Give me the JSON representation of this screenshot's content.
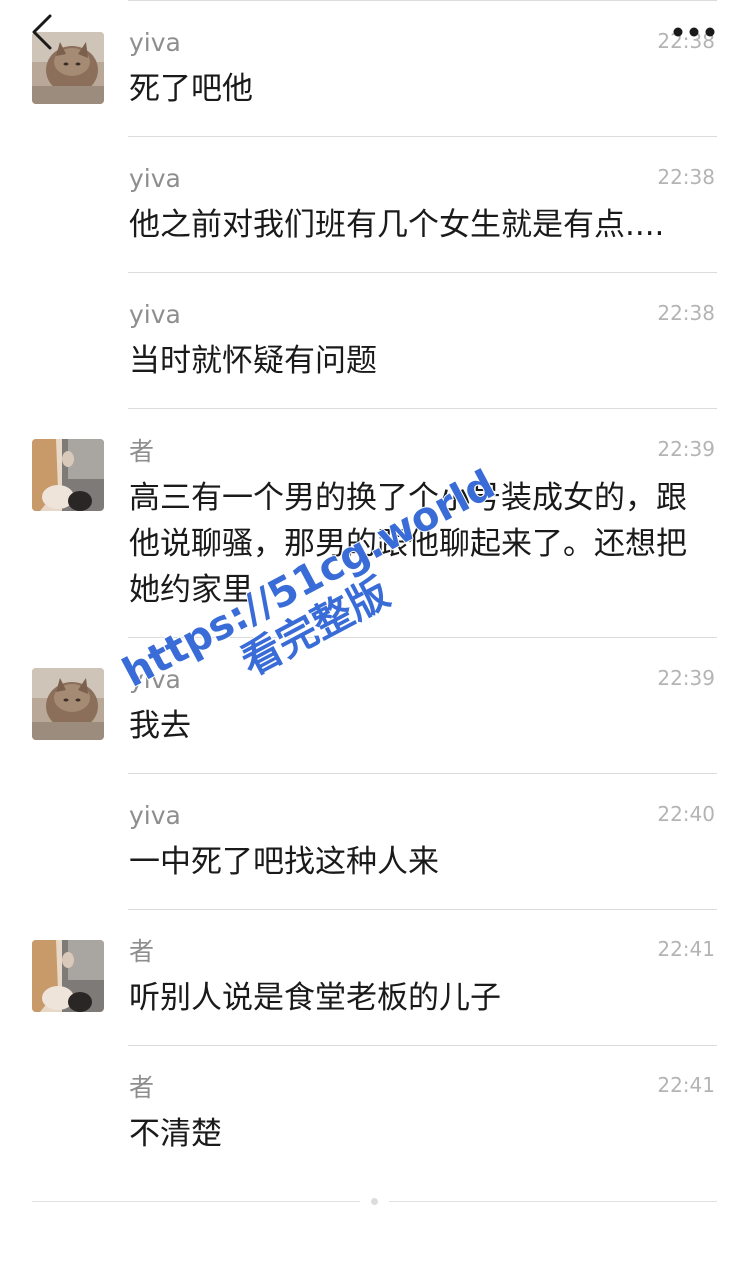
{
  "header": {
    "back_icon": "chevron-left-icon",
    "more_icon": "more-dots-icon"
  },
  "messages": [
    {
      "sender": "yiva",
      "time": "22:38",
      "text": "死了吧他",
      "avatar": "cat-avatar"
    },
    {
      "sender": "yiva",
      "time": "22:38",
      "text": "他之前对我们班有几个女生就是有点....",
      "avatar": ""
    },
    {
      "sender": "yiva",
      "time": "22:38",
      "text": "当时就怀疑有问题",
      "avatar": ""
    },
    {
      "sender": "者",
      "time": "22:39",
      "text": "高三有一个男的换了个小号装成女的，跟他说聊骚，那男的跟他聊起来了。还想把她约家里",
      "avatar": "girl-avatar"
    },
    {
      "sender": "yiva",
      "time": "22:39",
      "text": "我去",
      "avatar": "cat-avatar"
    },
    {
      "sender": "yiva",
      "time": "22:40",
      "text": "一中死了吧找这种人来",
      "avatar": ""
    },
    {
      "sender": "者",
      "time": "22:41",
      "text": "听别人说是食堂老板的儿子",
      "avatar": "girl-avatar"
    },
    {
      "sender": "者",
      "time": "22:41",
      "text": "不清楚",
      "avatar": ""
    }
  ],
  "watermark": {
    "line1": "https://51cg.world",
    "line2": "看完整版"
  },
  "colors": {
    "sender": "#8e8e8e",
    "time": "#b4b4b4",
    "text": "#1a1a1a",
    "divider": "#dcdcdc",
    "watermark": "#3a6cd8"
  }
}
